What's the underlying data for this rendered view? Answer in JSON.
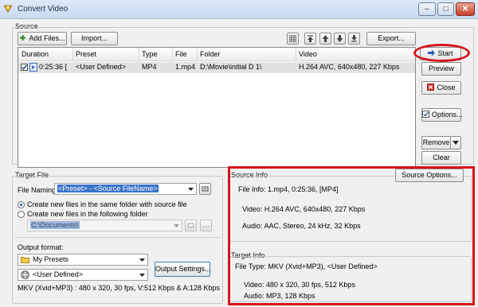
{
  "window": {
    "title": "Convert Video",
    "controls": {
      "minimize": "–",
      "maximize": "□",
      "close": "✕"
    }
  },
  "source": {
    "group_label": "Source",
    "add_files_label": "Add Files...",
    "import_label": "Import...",
    "export_label": "Export...",
    "columns": [
      "Duration",
      "Preset",
      "Type",
      "File",
      "Folder",
      "Video"
    ],
    "rows": [
      {
        "duration": "0:25:36 [",
        "preset": "<User Defined>",
        "type": "MP4",
        "file": "1.mp4",
        "folder": "D:\\Movie\\initial D 1\\",
        "video": "H.264 AVC, 640x480, 227 Kbps",
        "checked": true
      }
    ],
    "side_buttons": {
      "start": "Start",
      "preview": "Preview",
      "close": "Close",
      "options": "Options...",
      "remove": "Remove",
      "clear": "Clear"
    }
  },
  "target_file": {
    "group_label": "Target File",
    "naming_label": "File Naming:",
    "naming_value": "<Preset> - <Source FileName>",
    "radio_same": "Create new files in the same folder with source file",
    "radio_following": "Create new files in the following folder",
    "folder_value": "C:\\Documents\\",
    "output_format_label": "Output format:",
    "preset_folder": "My Presets",
    "preset": "<User Defined>",
    "output_settings_label": "Output Settings...",
    "format_summary": "MKV (Xvid+MP3) : 480 x 320, 30 fps, V:512 Kbps & A:128 Kbps"
  },
  "source_info": {
    "group_label": "Source Info",
    "options_label": "Source Options...",
    "file_info": "File Info:  1.mp4, 0:25:36,  [MP4]",
    "video": "Video:  H.264 AVC, 640x480, 227 Kbps",
    "audio": "Audio:  AAC, Stereo, 24 kHz, 32 Kbps"
  },
  "target_info": {
    "group_label": "Target Info",
    "file_type": "File Type:  MKV (Xvid+MP3), <User Defined>",
    "video": "Video:  480 x 320, 30 fps, 512 Kbps",
    "audio": "Audio:  MP3, 128 Kbps"
  },
  "colors": {
    "highlight_red": "#d4141a",
    "selection_blue": "#3a73c9"
  }
}
